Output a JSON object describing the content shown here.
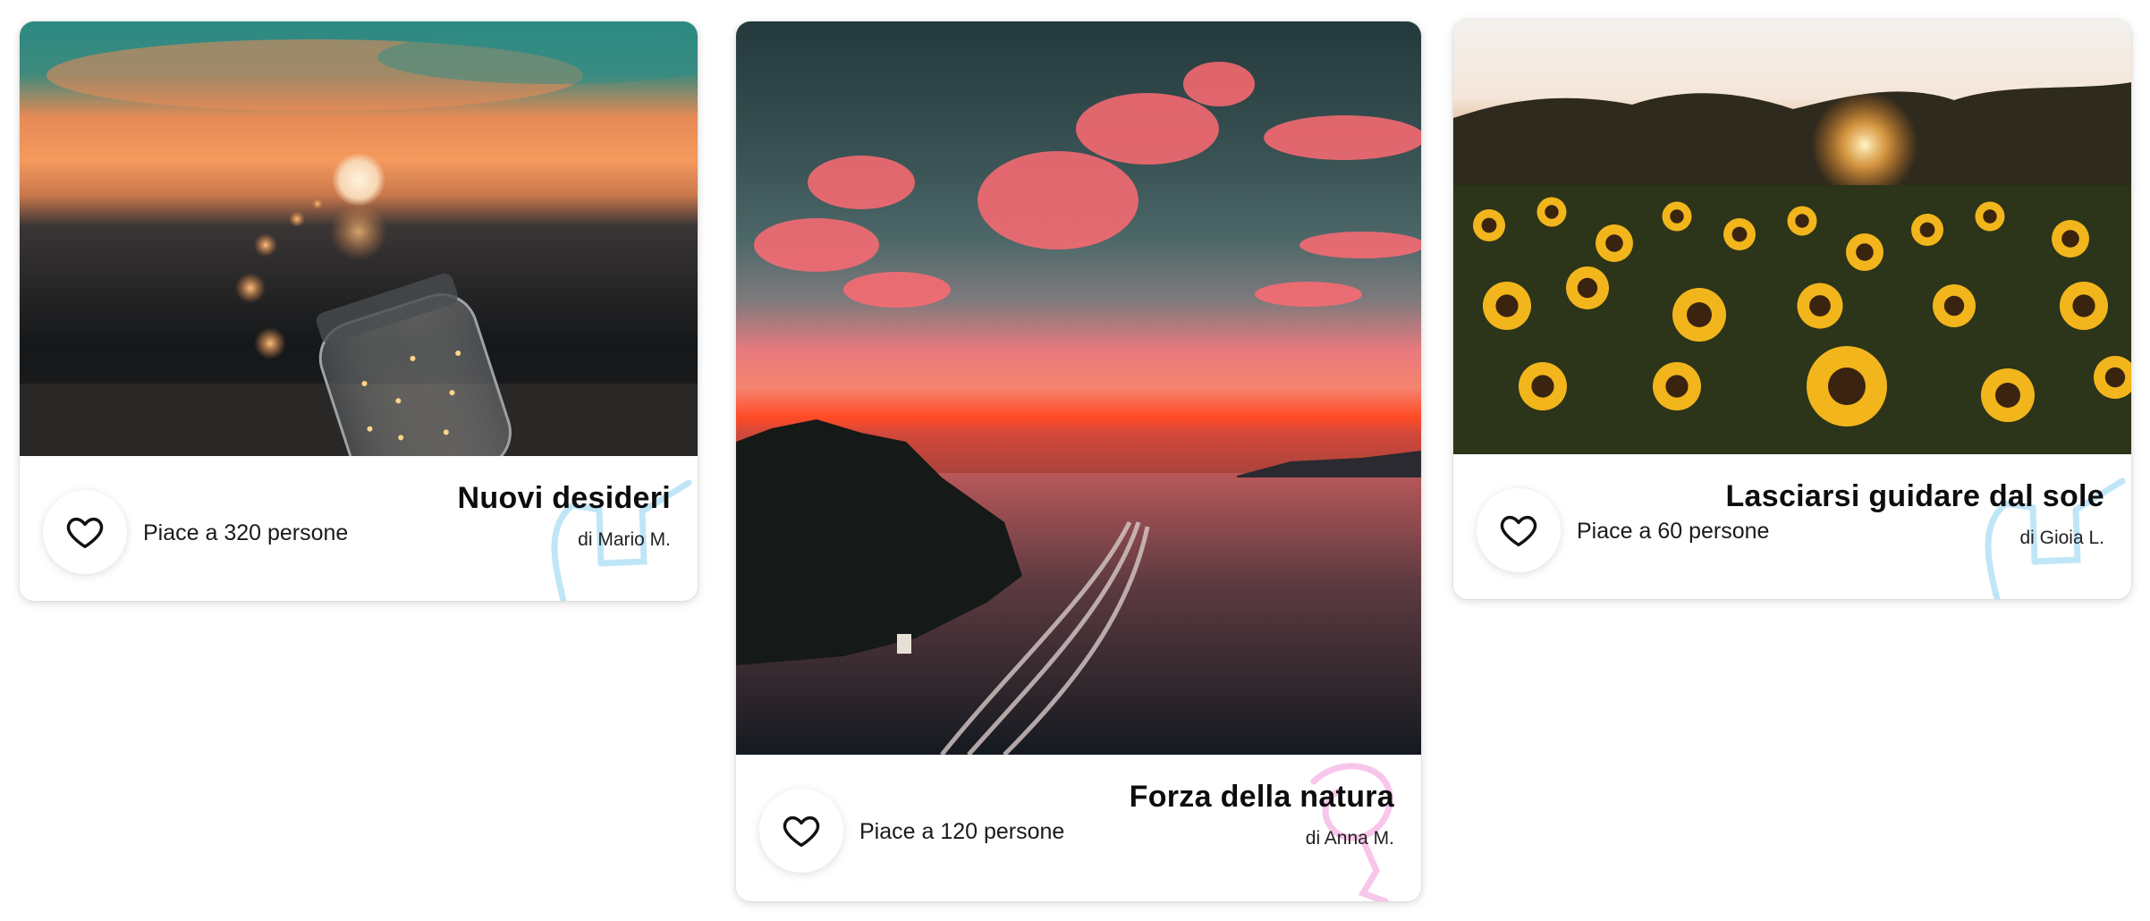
{
  "cards": [
    {
      "title": "Nuovi desideri",
      "author": "di Mario M.",
      "likes": "Piace a 320 persone",
      "doodle_color": "#bfe6f7",
      "photo_subject": "glass jar with fairy lights at sunset"
    },
    {
      "title": "Forza della natura",
      "author": "di Anna M.",
      "likes": "Piace a 120 persone",
      "doodle_color": "#f8c6ea",
      "photo_subject": "red sunset sky over water with boat wake"
    },
    {
      "title": "Lasciarsi guidare dal sole",
      "author": "di Gioia L.",
      "likes": "Piace a 60 persone",
      "doodle_color": "#bfe6f7",
      "photo_subject": "sunflower field at sunset"
    }
  ],
  "icons": {
    "like": "heart-outline-icon"
  }
}
